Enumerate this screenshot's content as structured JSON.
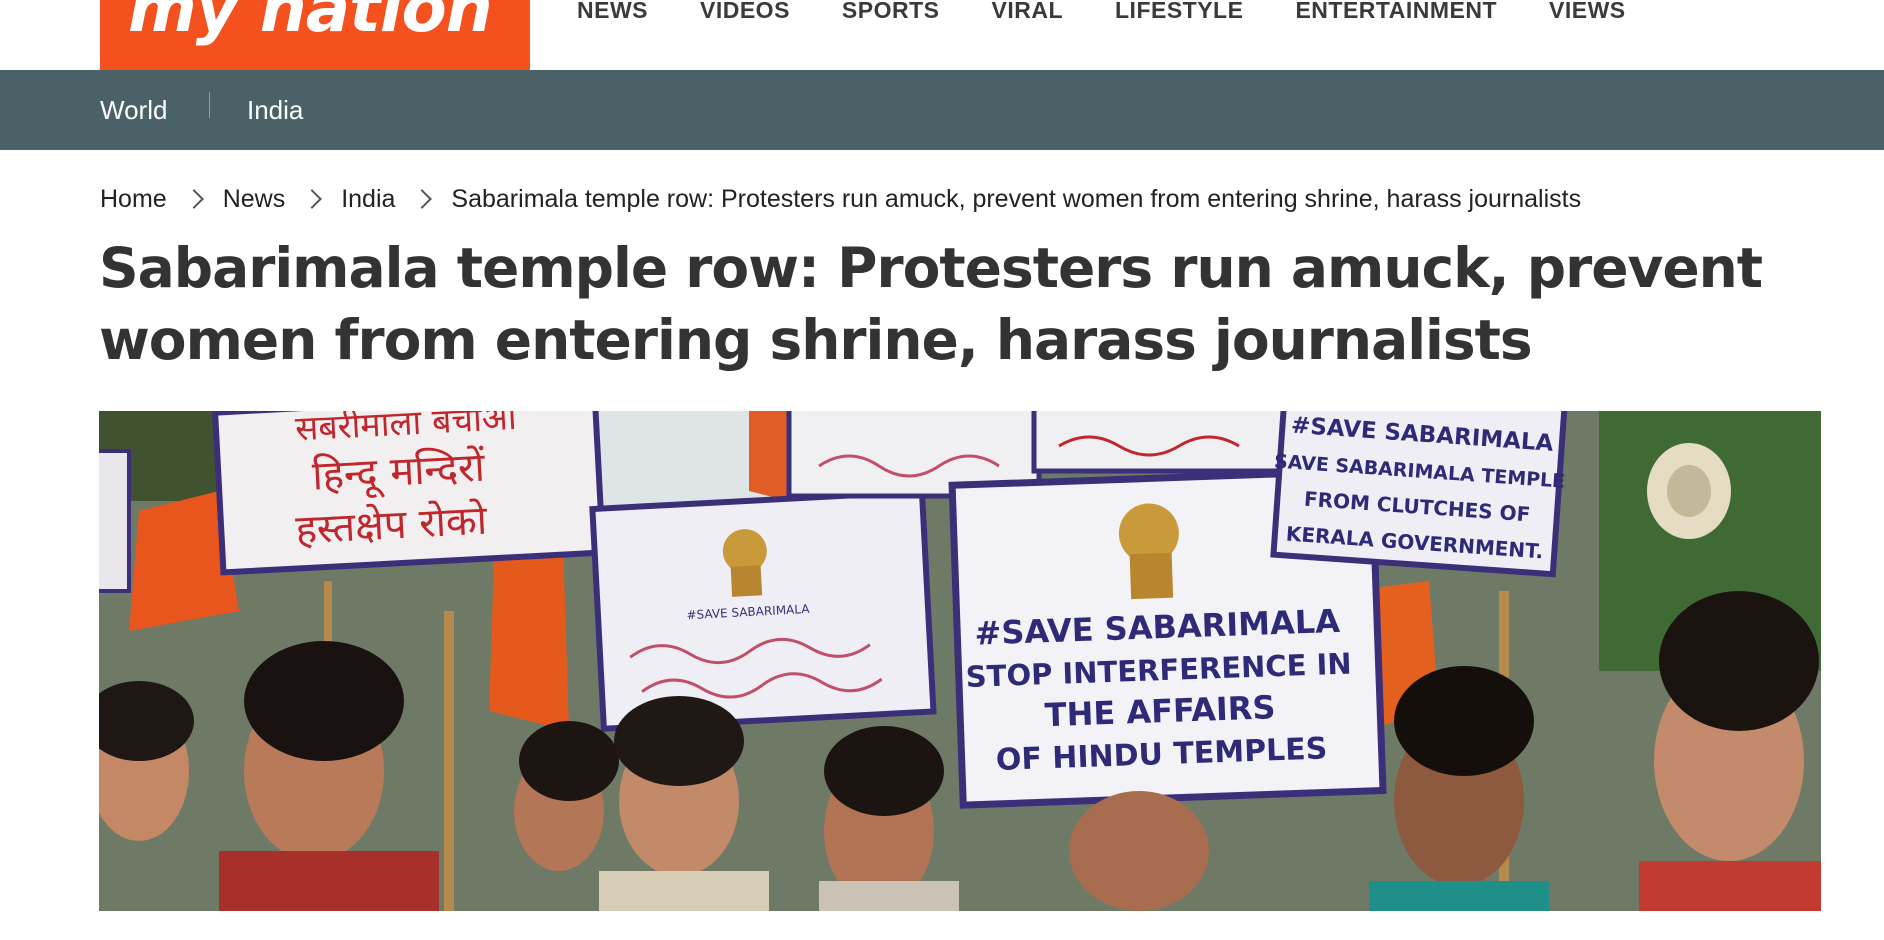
{
  "header": {
    "logo_text": "my nation",
    "nav": [
      "NEWS",
      "VIDEOS",
      "SPORTS",
      "VIRAL",
      "LIFESTYLE",
      "ENTERTAINMENT",
      "VIEWS"
    ]
  },
  "subnav": {
    "items": [
      "World",
      "India"
    ]
  },
  "breadcrumb": {
    "home": "Home",
    "news": "News",
    "india": "India",
    "current": "Sabarimala temple row: Protesters run amuck, prevent women from entering shrine, harass journalists"
  },
  "article": {
    "headline": "Sabarimala temple row: Protesters run amuck, prevent women from entering shrine, harass journalists"
  },
  "hero": {
    "sign_hindi_line1": "सबरीमाला बचाओ",
    "sign_hindi_line2": "हिन्दू मन्दिरों",
    "sign_hindi_line3": "हस्तक्षेप रोको",
    "sign_small_tag": "#SAVE SABARIMALA",
    "sign_main_line1": "#SAVE SABARIMALA",
    "sign_main_line2": "STOP INTERFERENCE IN",
    "sign_main_line3": "THE AFFAIRS",
    "sign_main_line4": "OF HINDU TEMPLES",
    "sign_right_line1": "#SAVE SABARIMALA",
    "sign_right_line2": "SAVE SABARIMALA TEMPLE",
    "sign_right_line3": "FROM CLUTCHES OF",
    "sign_right_line4": "KERALA GOVERNMENT."
  },
  "colors": {
    "logo_bg": "#f4511e",
    "subnav_bg": "#4a6168",
    "headline": "#333333"
  }
}
